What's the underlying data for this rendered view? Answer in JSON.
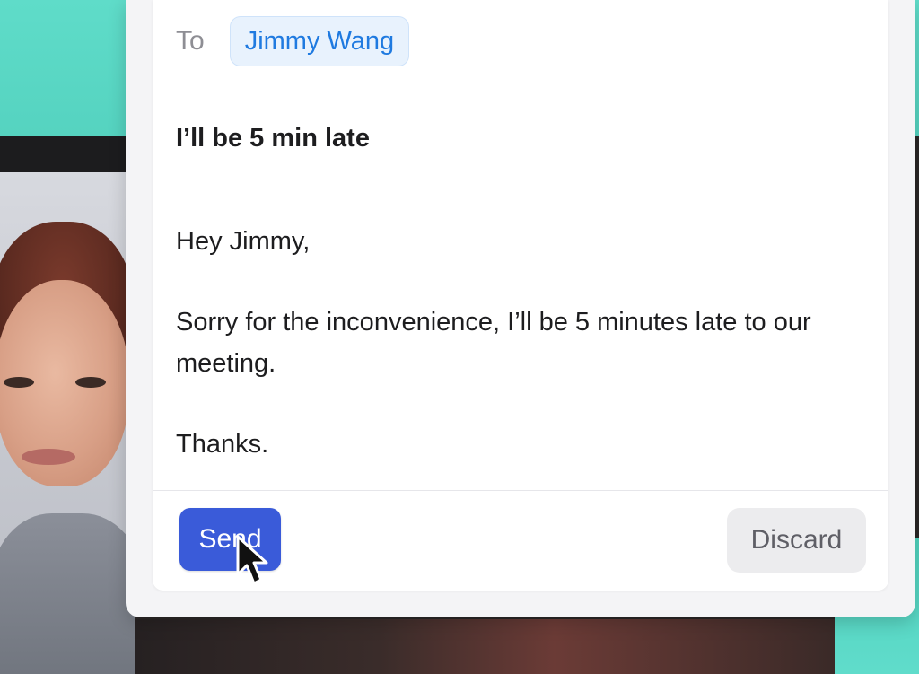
{
  "email": {
    "to_label": "To",
    "recipient": "Jimmy Wang",
    "subject": "I’ll be 5 min late",
    "body": {
      "greeting": "Hey Jimmy,",
      "paragraph": "Sorry for the inconvenience, I’ll be 5 minutes late to our meeting.",
      "signoff": "Thanks."
    }
  },
  "actions": {
    "send_label": "Send",
    "discard_label": "Discard"
  },
  "colors": {
    "send_button": "#3a5bd9",
    "recipient_chip_text": "#1f7ae0",
    "recipient_chip_bg": "#e8f2fd",
    "discard_button_bg": "#ececee",
    "background_accent": "#5fdcc9"
  },
  "icons": {
    "cursor": "mouse-pointer-icon"
  }
}
